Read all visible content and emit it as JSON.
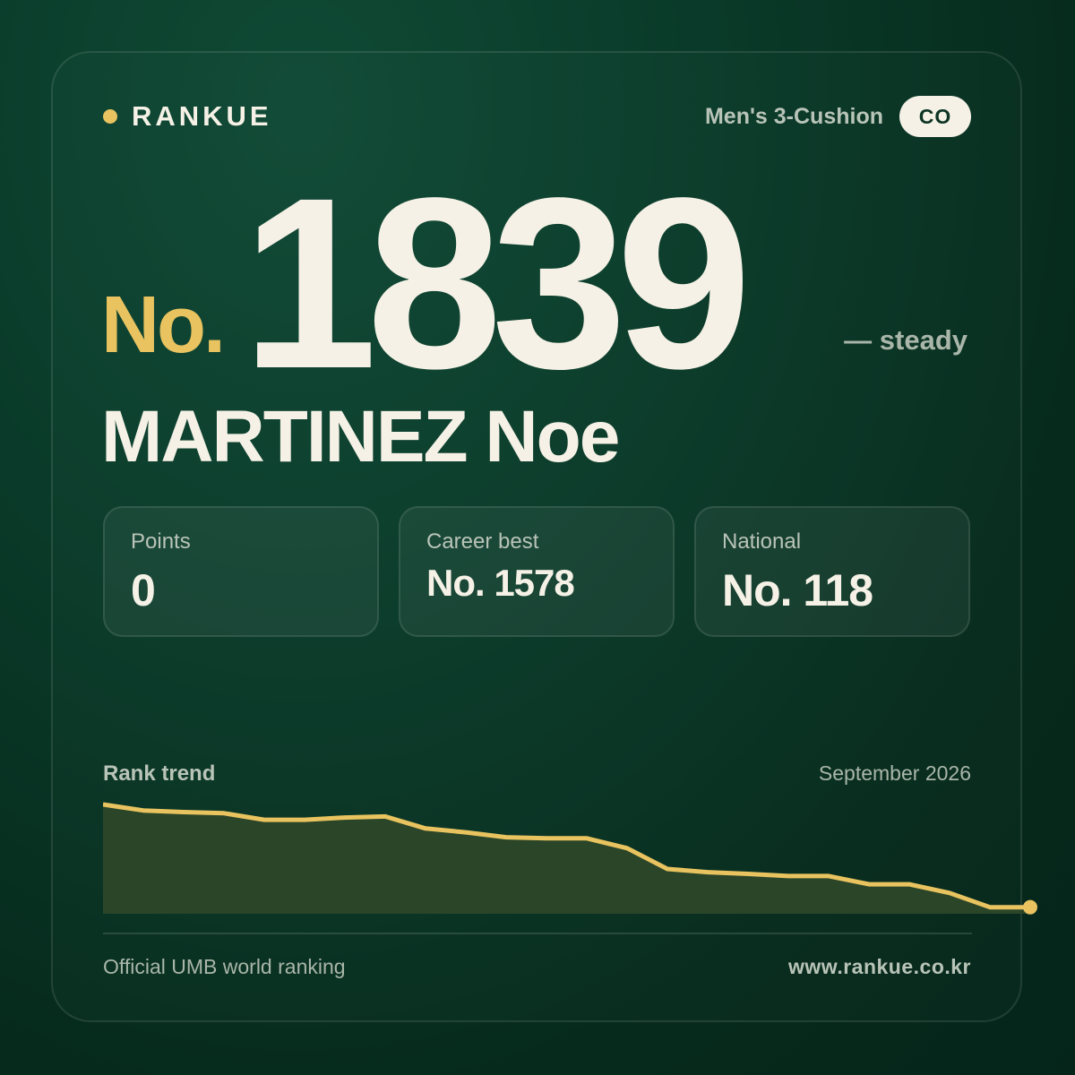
{
  "brand": {
    "name": "RANKUE",
    "dot_color": "#e8c35f"
  },
  "header": {
    "category": "Men's 3-Cushion",
    "country_code": "CO"
  },
  "rank": {
    "prefix": "No.",
    "number": "1839",
    "trend": "— steady"
  },
  "player": {
    "name": "MARTINEZ Noe"
  },
  "stats": [
    {
      "label": "Points",
      "value": "0"
    },
    {
      "label": "Career best",
      "value": "No. 1578"
    },
    {
      "label": "National",
      "value": "No. 118"
    }
  ],
  "trend": {
    "title": "Rank trend",
    "date": "September 2026",
    "line_color": "#e8c35f",
    "fill_color": "#2b4529"
  },
  "chart_data": {
    "type": "area",
    "title": "Rank trend",
    "xlabel": "",
    "ylabel": "",
    "grid": false,
    "x": [
      1,
      2,
      3,
      4,
      5,
      6,
      7,
      8,
      9,
      10,
      11,
      12,
      13,
      14,
      15,
      16,
      17,
      18,
      19,
      20,
      21,
      22,
      23,
      24
    ],
    "series": [
      {
        "values": [
          1,
          0.945,
          0.93,
          0.92,
          0.86,
          0.86,
          0.88,
          0.89,
          0.78,
          0.745,
          0.7,
          0.69,
          0.69,
          0.6,
          0.41,
          0.38,
          0.365,
          0.345,
          0.345,
          0.27,
          0.27,
          0.19,
          0.06,
          0.06
        ]
      }
    ],
    "ylim": [
      0,
      1
    ]
  },
  "footer": {
    "left": "Official UMB world ranking",
    "right": "www.rankue.co.kr"
  }
}
